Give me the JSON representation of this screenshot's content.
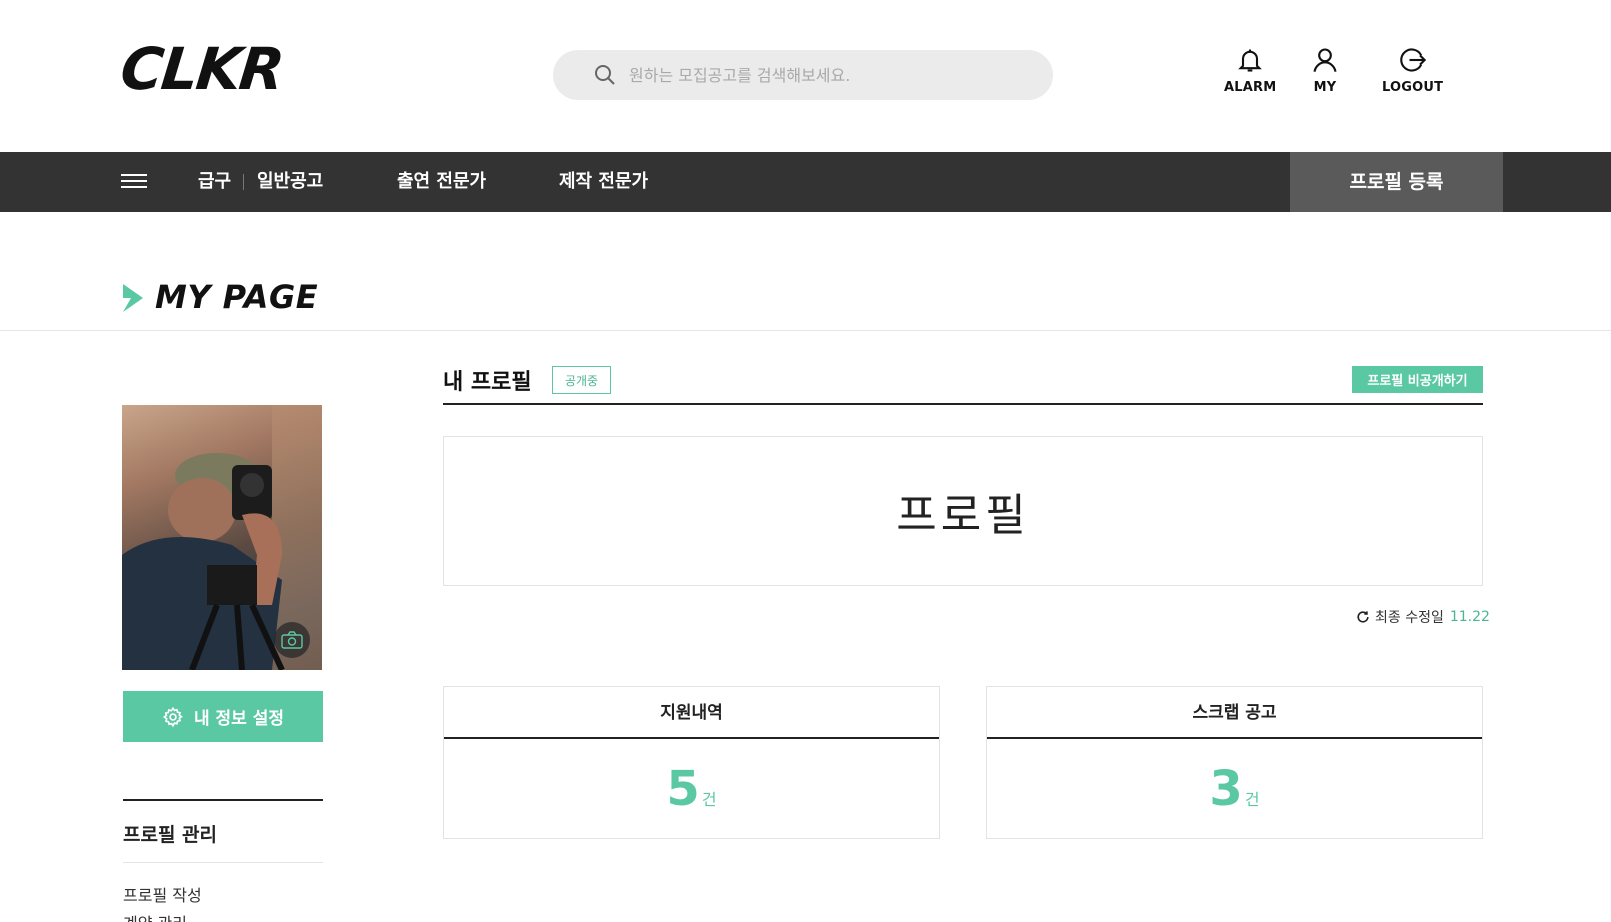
{
  "header": {
    "logo": "CLKR",
    "search_placeholder": "원하는 모집공고를 검색해보세요.",
    "icons": [
      {
        "name": "bell-icon",
        "label": "ALARM"
      },
      {
        "name": "user-icon",
        "label": "MY"
      },
      {
        "name": "logout-icon",
        "label": "LOGOUT"
      }
    ]
  },
  "nav": {
    "items": [
      "급구",
      "일반공고",
      "출연 전문가",
      "제작 전문가"
    ],
    "register_label": "프로필 등록"
  },
  "page": {
    "title": "MY PAGE"
  },
  "sidebar": {
    "settings_label": "내 정보 설정",
    "section_heading": "프로필 관리",
    "links": [
      "프로필 작성",
      "계약 관리"
    ]
  },
  "main": {
    "profile_heading": "내 프로필",
    "public_badge": "공개중",
    "private_button": "프로필 비공개하기",
    "profile_placeholder": "프로필",
    "modified_label": "최종 수정일",
    "modified_date": "11.22",
    "stats": [
      {
        "label": "지원내역",
        "value": "5",
        "unit": "건"
      },
      {
        "label": "스크랩 공고",
        "value": "3",
        "unit": "건"
      }
    ]
  },
  "colors": {
    "accent": "#5bc8a4",
    "nav_bg": "#333333",
    "nav_highlight": "#5a5a5a"
  }
}
